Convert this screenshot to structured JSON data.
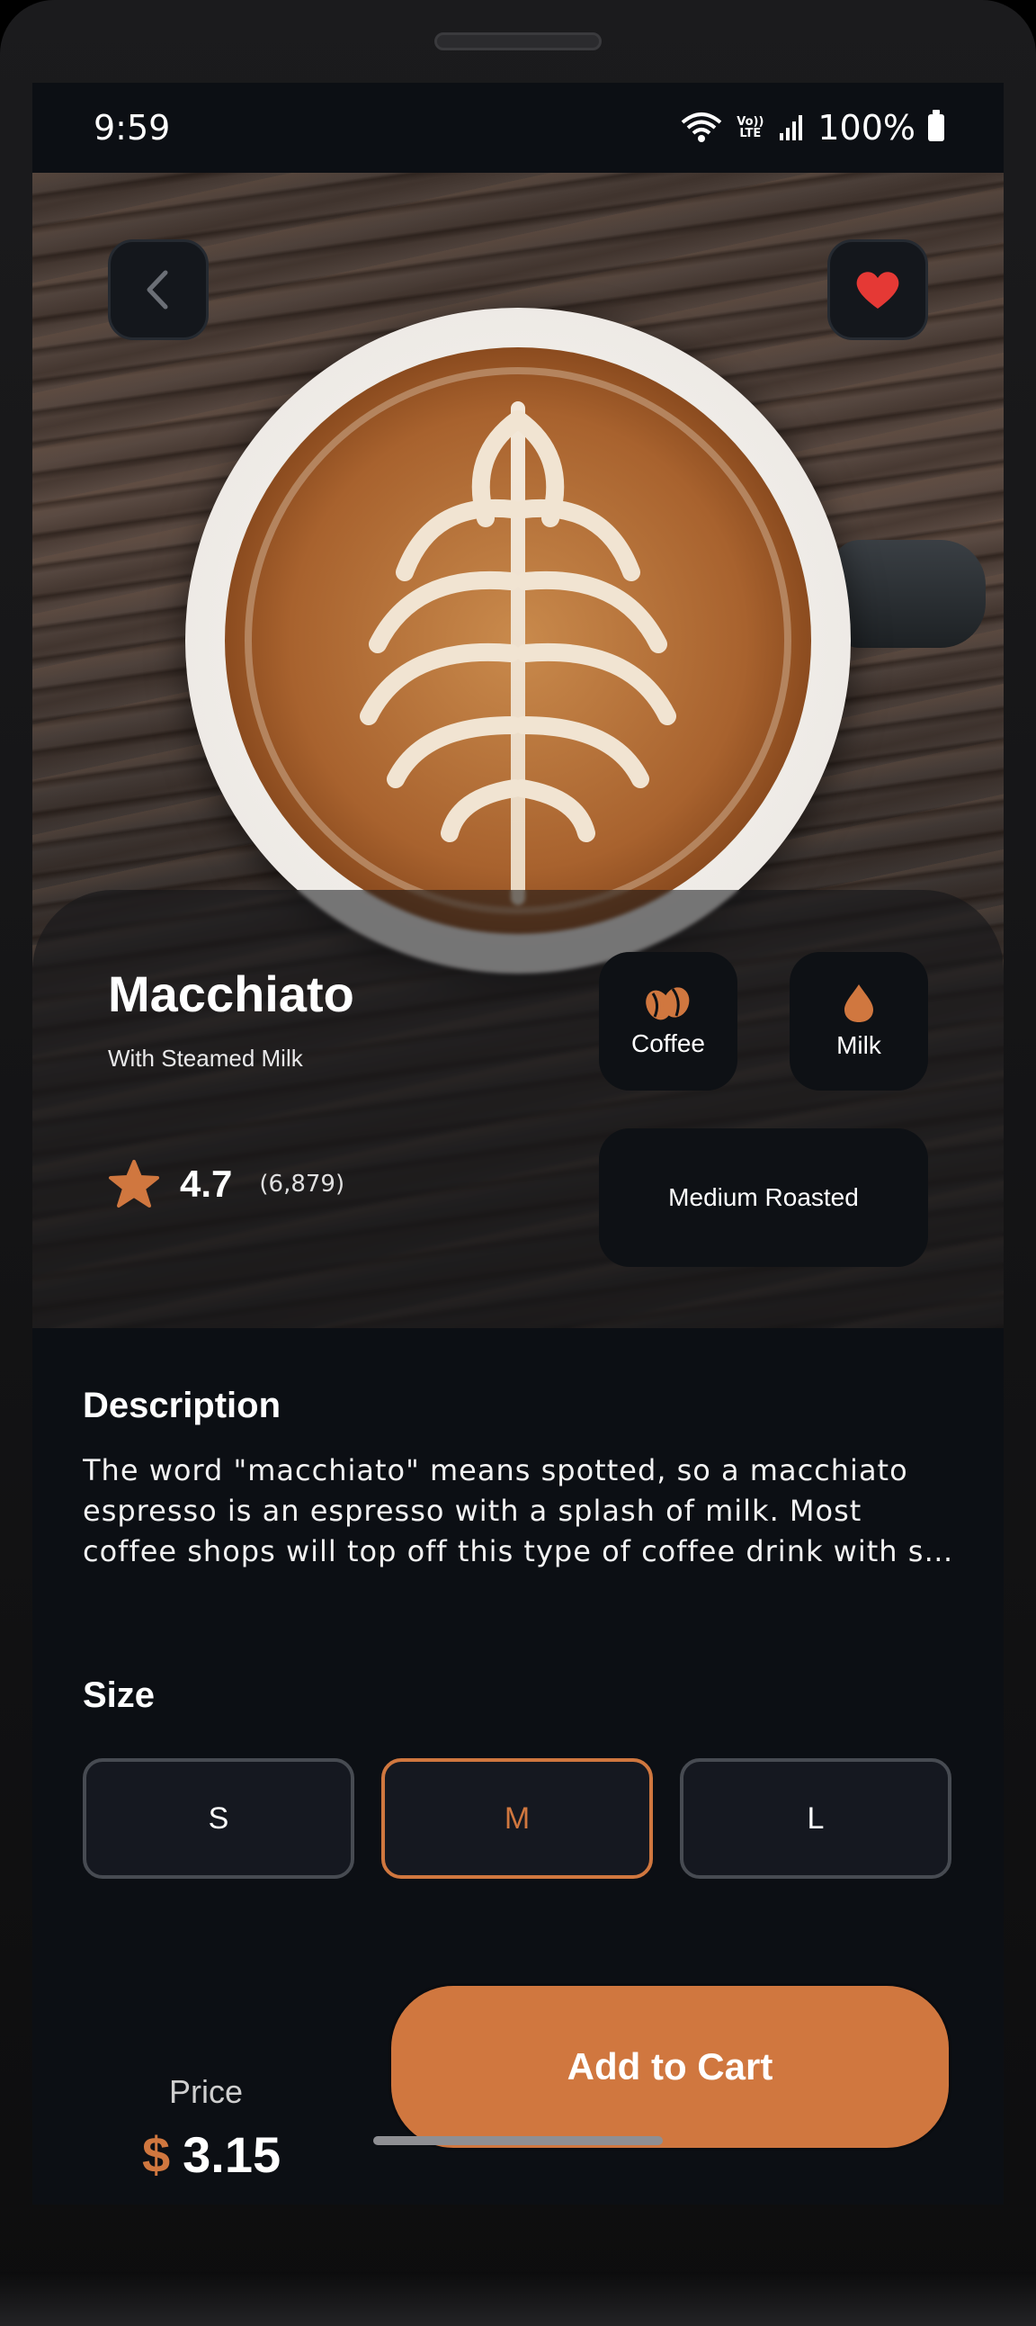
{
  "status_bar": {
    "time": "9:59",
    "volte": "Vo)) LTE",
    "battery": "100%"
  },
  "product": {
    "name": "Macchiato",
    "subtitle": "With Steamed Milk",
    "rating": "4.7",
    "rating_count": "(6,879)",
    "chips": {
      "coffee": "Coffee",
      "milk": "Milk",
      "roast": "Medium Roasted"
    }
  },
  "description": {
    "heading": "Description",
    "text": "The word \"macchiato\" means spotted, so a macchiato espresso is an espresso with a splash of milk. Most coffee shops will top off this type of coffee drink with s…"
  },
  "size": {
    "heading": "Size",
    "options": [
      "S",
      "M",
      "L"
    ],
    "selected": "M"
  },
  "footer": {
    "price_label": "Price",
    "currency": "$",
    "price": "3.15",
    "cart_button": "Add to Cart"
  },
  "colors": {
    "accent": "#d0773f",
    "background": "#0c0f14",
    "heart": "#e53935"
  },
  "icons": {
    "back": "chevron-left-icon",
    "favorite": "heart-icon",
    "rating": "star-icon",
    "coffee": "coffee-beans-icon",
    "milk": "milk-drop-icon"
  }
}
